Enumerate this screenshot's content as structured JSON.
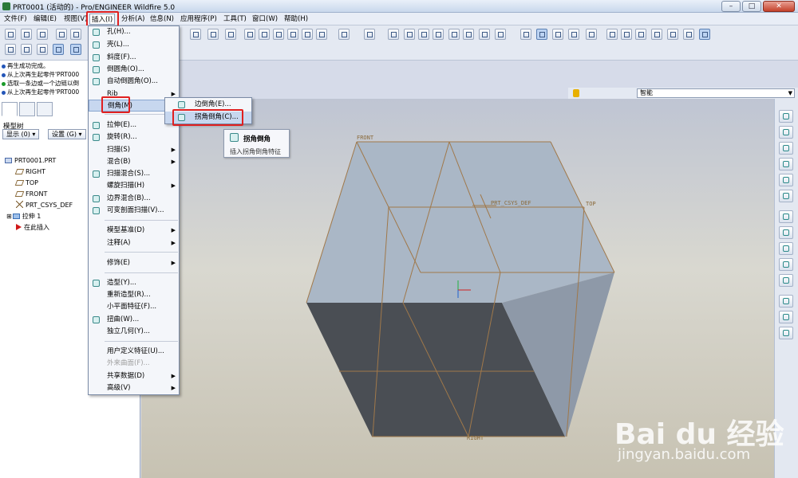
{
  "window": {
    "title": "PRT0001 (活动的) - Pro/ENGINEER Wildfire 5.0",
    "minimize": "–",
    "maximize": "□",
    "close": "✕"
  },
  "menubar": {
    "items": [
      {
        "label": "文件(F)"
      },
      {
        "label": "编辑(E)"
      },
      {
        "label": "视图(V)"
      },
      {
        "label": "插入(I)"
      },
      {
        "label": "分析(A)"
      },
      {
        "label": "信息(N)"
      },
      {
        "label": "应用程序(P)"
      },
      {
        "label": "工具(T)"
      },
      {
        "label": "窗口(W)"
      },
      {
        "label": "帮助(H)"
      }
    ]
  },
  "messages": [
    {
      "text": "再生成功完成。",
      "kind": "info"
    },
    {
      "text": "从上次再生起零件'PRT000",
      "kind": "info"
    },
    {
      "text": "选取一条边或一个边链以倒",
      "kind": "prompt"
    },
    {
      "text": "从上次再生起零件'PRT000",
      "kind": "info"
    }
  ],
  "model_tree": {
    "label": "模型树",
    "show_button": "显示 (0) ▾",
    "settings_button": "设置 (G) ▾",
    "items": [
      {
        "label": "PRT0001.PRT",
        "icon": "part-icon"
      },
      {
        "label": "RIGHT",
        "icon": "datum-plane-icon"
      },
      {
        "label": "TOP",
        "icon": "datum-plane-icon"
      },
      {
        "label": "FRONT",
        "icon": "datum-plane-icon"
      },
      {
        "label": "PRT_CSYS_DEF",
        "icon": "csys-icon"
      },
      {
        "label": "拉伸 1",
        "icon": "extrude-icon"
      },
      {
        "label": "在此插入",
        "icon": "insert-here-icon"
      }
    ]
  },
  "insert_menu": {
    "items": [
      {
        "label": "孔(H)...",
        "icon": true
      },
      {
        "label": "壳(L)...",
        "icon": true
      },
      {
        "label": "斜度(F)...",
        "icon": true
      },
      {
        "label": "倒圆角(O)...",
        "icon": true
      },
      {
        "label": "自动倒圆角(O)...",
        "icon": true
      },
      {
        "label": "Rib",
        "submenu": true
      },
      {
        "label": "倒角(M)",
        "submenu": true,
        "highlighted": true
      },
      {
        "label": "拉伸(E)...",
        "icon": true
      },
      {
        "label": "旋转(R)...",
        "icon": true
      },
      {
        "label": "扫描(S)",
        "submenu": true
      },
      {
        "label": "混合(B)",
        "submenu": true
      },
      {
        "label": "扫描混合(S)...",
        "icon": true
      },
      {
        "label": "螺旋扫描(H)",
        "submenu": true
      },
      {
        "label": "边界混合(B)...",
        "icon": true
      },
      {
        "label": "可变剖面扫描(V)...",
        "icon": true
      },
      {
        "label": "模型基准(D)",
        "submenu": true
      },
      {
        "label": "注释(A)",
        "submenu": true
      },
      {
        "label": "修饰(E)",
        "submenu": true
      },
      {
        "label": "造型(Y)...",
        "icon": true
      },
      {
        "label": "重新造型(R)..."
      },
      {
        "label": "小平面特征(F)..."
      },
      {
        "label": "扭曲(W)...",
        "icon": true
      },
      {
        "label": "独立几何(Y)..."
      },
      {
        "label": "用户定义特征(U)..."
      },
      {
        "label": "外来曲面(F)...",
        "disabled": true
      },
      {
        "label": "共享数据(D)",
        "submenu": true
      },
      {
        "label": "高级(V)",
        "submenu": true
      }
    ],
    "submenu_arrow": "▶"
  },
  "chamfer_submenu": {
    "items": [
      {
        "label": "边倒角(E)..."
      },
      {
        "label": "拐角倒角(C)...",
        "highlighted": true
      }
    ]
  },
  "tooltip": {
    "title": "拐角倒角",
    "description": "插入拐角倒角特征"
  },
  "filter": {
    "selected": "智能",
    "arrow": "▼"
  },
  "graphics": {
    "plane_labels": {
      "front": "FRONT",
      "top": "TOP",
      "right": "RIGHT",
      "csys": "PRT_CSYS_DEF"
    },
    "colors": {
      "top_face": "#aab7c6",
      "left_face": "#4a4e54",
      "right_face": "#8e99a8",
      "datum_line": "#a0784a"
    }
  },
  "watermark": {
    "logo": "Bai du 经验",
    "url": "jingyan.baidu.com"
  }
}
